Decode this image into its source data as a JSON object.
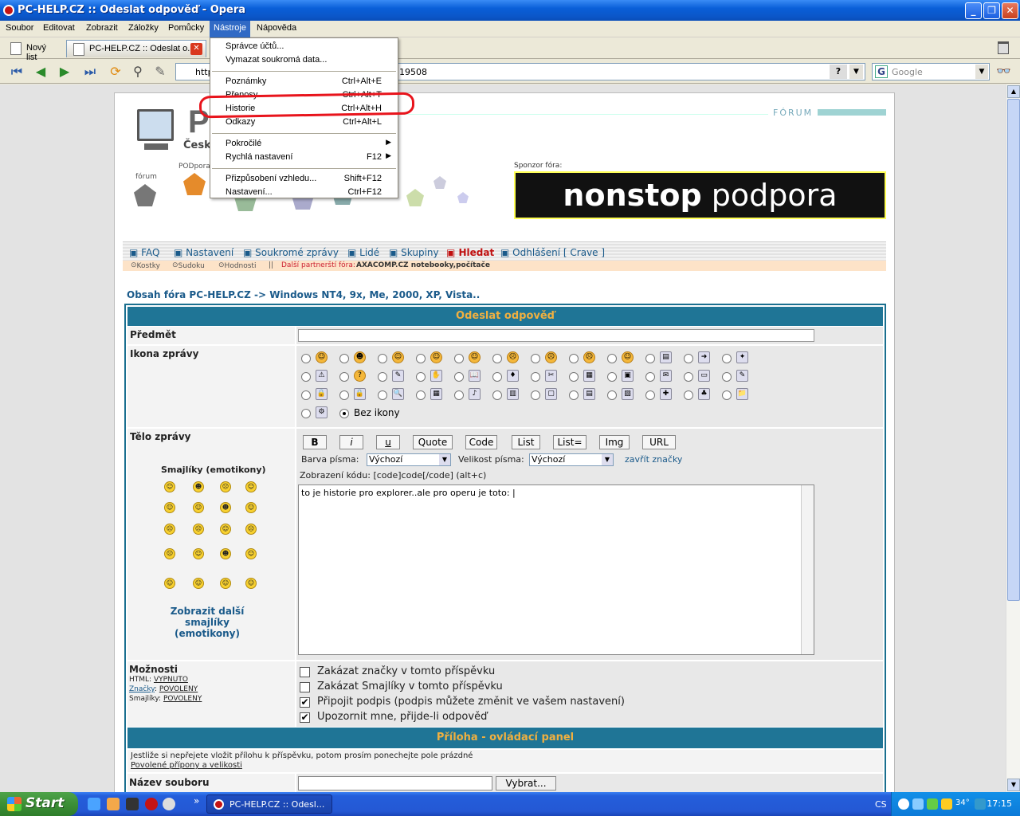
{
  "window": {
    "title": "PC-HELP.CZ :: Odeslat odpověď - Opera",
    "buttons": {
      "minimize": "_",
      "maximize": "❐",
      "close": "✕"
    }
  },
  "menubar": {
    "items": [
      "Soubor",
      "Editovat",
      "Zobrazit",
      "Záložky",
      "Pomůcky",
      "Nástroje",
      "Nápověda"
    ],
    "active": "Nástroje"
  },
  "tabs": {
    "new_tab_label": "Nový list",
    "current_tab_label": "PC-HELP.CZ :: Odeslat o..."
  },
  "toolbar": {
    "address_visible_start": "http",
    "address_visible_end": "19508",
    "search_placeholder": "Google",
    "help_glyph": "?"
  },
  "dropdown_menu": {
    "groups": [
      [
        {
          "label": "Správce účtů...",
          "shortcut": ""
        },
        {
          "label": "Vymazat soukromá data...",
          "shortcut": ""
        }
      ],
      [
        {
          "label": "Poznámky",
          "shortcut": "Ctrl+Alt+E"
        },
        {
          "label": "Přenosy",
          "shortcut": "Ctrl+Alt+T"
        },
        {
          "label": "Historie",
          "shortcut": "Ctrl+Alt+H"
        },
        {
          "label": "Odkazy",
          "shortcut": "Ctrl+Alt+L"
        }
      ],
      [
        {
          "label": "Pokročilé",
          "shortcut": "",
          "submenu": true
        },
        {
          "label": "Rychlá nastavení",
          "shortcut": "F12",
          "submenu": true
        }
      ],
      [
        {
          "label": "Přizpůsobení vzhledu...",
          "shortcut": "Shift+F12"
        },
        {
          "label": "Nastavení...",
          "shortcut": "Ctrl+F12"
        }
      ]
    ],
    "highlighted_item": "Historie",
    "annotation_color": "#e8141c"
  },
  "page": {
    "logo_letter": "P",
    "logo_text": "Česk",
    "forum_header": "FÓRUM",
    "nav_icons": [
      "fórum",
      "PODpora"
    ],
    "sponsor_label": "Sponzor fóra:",
    "sponsor_banner": {
      "bold": "nonstop",
      "normal": " podpora"
    },
    "nav": [
      "FAQ",
      "Nastavení",
      "Soukromé zprávy",
      "Lidé",
      "Skupiny",
      "Hledat",
      "Odhlášení [ Crave ]"
    ],
    "subnav": {
      "kostky": "Kostky",
      "sudoku": "Sudoku",
      "hodnosti": "Hodnosti",
      "sep": "||",
      "partner_label": "Další partnerští fóra:",
      "partner": "AXACOMP.CZ notebooky,počítače"
    },
    "breadcrumb": "Obsah fóra PC-HELP.CZ -> Windows NT4, 9x, Me, 2000, XP, Vista.."
  },
  "form": {
    "header": "Odeslat odpověď",
    "subject_label": "Předmět",
    "subject_value": "",
    "icon_label": "Ikona zprávy",
    "no_icon_label": "Bez ikony",
    "body_label": "Tělo zprávy",
    "smileys_title": "Smajlíky (emotikony)",
    "more_smileys": "Zobrazit další smajlíky (emotikony)",
    "format_buttons": [
      "B",
      "i",
      "u",
      "Quote",
      "Code",
      "List",
      "List=",
      "Img",
      "URL"
    ],
    "font_color_label": "Barva písma:",
    "font_color_value": "Výchozí",
    "font_size_label": "Velikost písma:",
    "font_size_value": "Výchozí",
    "close_tags": "zavřít značky",
    "code_hint": "Zobrazení kódu: [code]code[/code]  (alt+c)",
    "message": "to je historie pro explorer..ale pro operu je toto: |",
    "options_label": "Možnosti",
    "options_html": "HTML:",
    "options_html_value": "VYPNUTO",
    "options_tags": "Značky",
    "options_tags_value": "POVOLENY",
    "options_smileys": "Smajlíky:",
    "options_smileys_value": "POVOLENY",
    "checkboxes": [
      {
        "label": "Zakázat značky v tomto příspěvku",
        "checked": false
      },
      {
        "label": "Zakázat Smajlíky v tomto příspěvku",
        "checked": false
      },
      {
        "label": "Připojit podpis (podpis můžete změnit ve vašem nastavení)",
        "checked": true
      },
      {
        "label": "Upozornit mne, přijde-li odpověď",
        "checked": true
      }
    ],
    "attach_header": "Příloha - ovládací panel",
    "attach_note": "Jestliže si nepřejete vložit přílohu k příspěvku, potom prosím ponechejte pole prázdné",
    "attach_link": "Povolené přípony a velikosti",
    "filename_label": "Název souboru",
    "browse_button": "Vybrat..."
  },
  "taskbar": {
    "start": "Start",
    "task": "PC-HELP.CZ :: Odesl...",
    "lang": "CS",
    "temperature": "34°",
    "clock": "17:15",
    "more": "»"
  }
}
